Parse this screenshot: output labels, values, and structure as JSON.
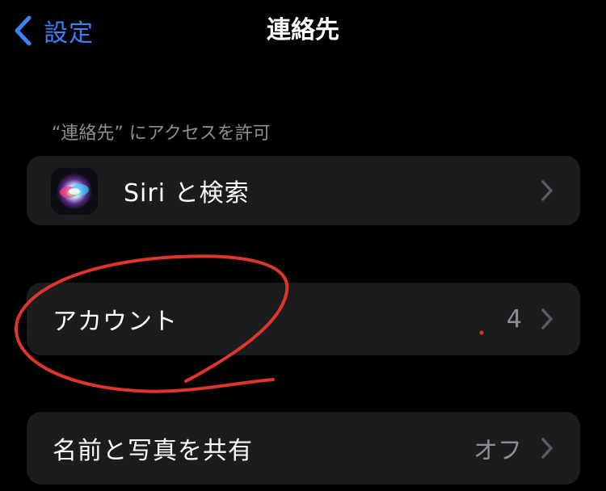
{
  "nav": {
    "back_label": "設定",
    "title": "連絡先"
  },
  "section": {
    "header": "“連絡先” にアクセスを許可"
  },
  "rows": [
    {
      "label": "Siri と検索",
      "value": "",
      "icon": "siri-icon"
    },
    {
      "label": "アカウント",
      "value": "4",
      "icon": ""
    },
    {
      "label": "名前と写真を共有",
      "value": "オフ",
      "icon": ""
    }
  ],
  "colors": {
    "background": "#000000",
    "cell": "#1c1c1e",
    "accent": "#3b82f6",
    "secondary_text": "#8e8e93",
    "annotation": "#e0352b"
  }
}
